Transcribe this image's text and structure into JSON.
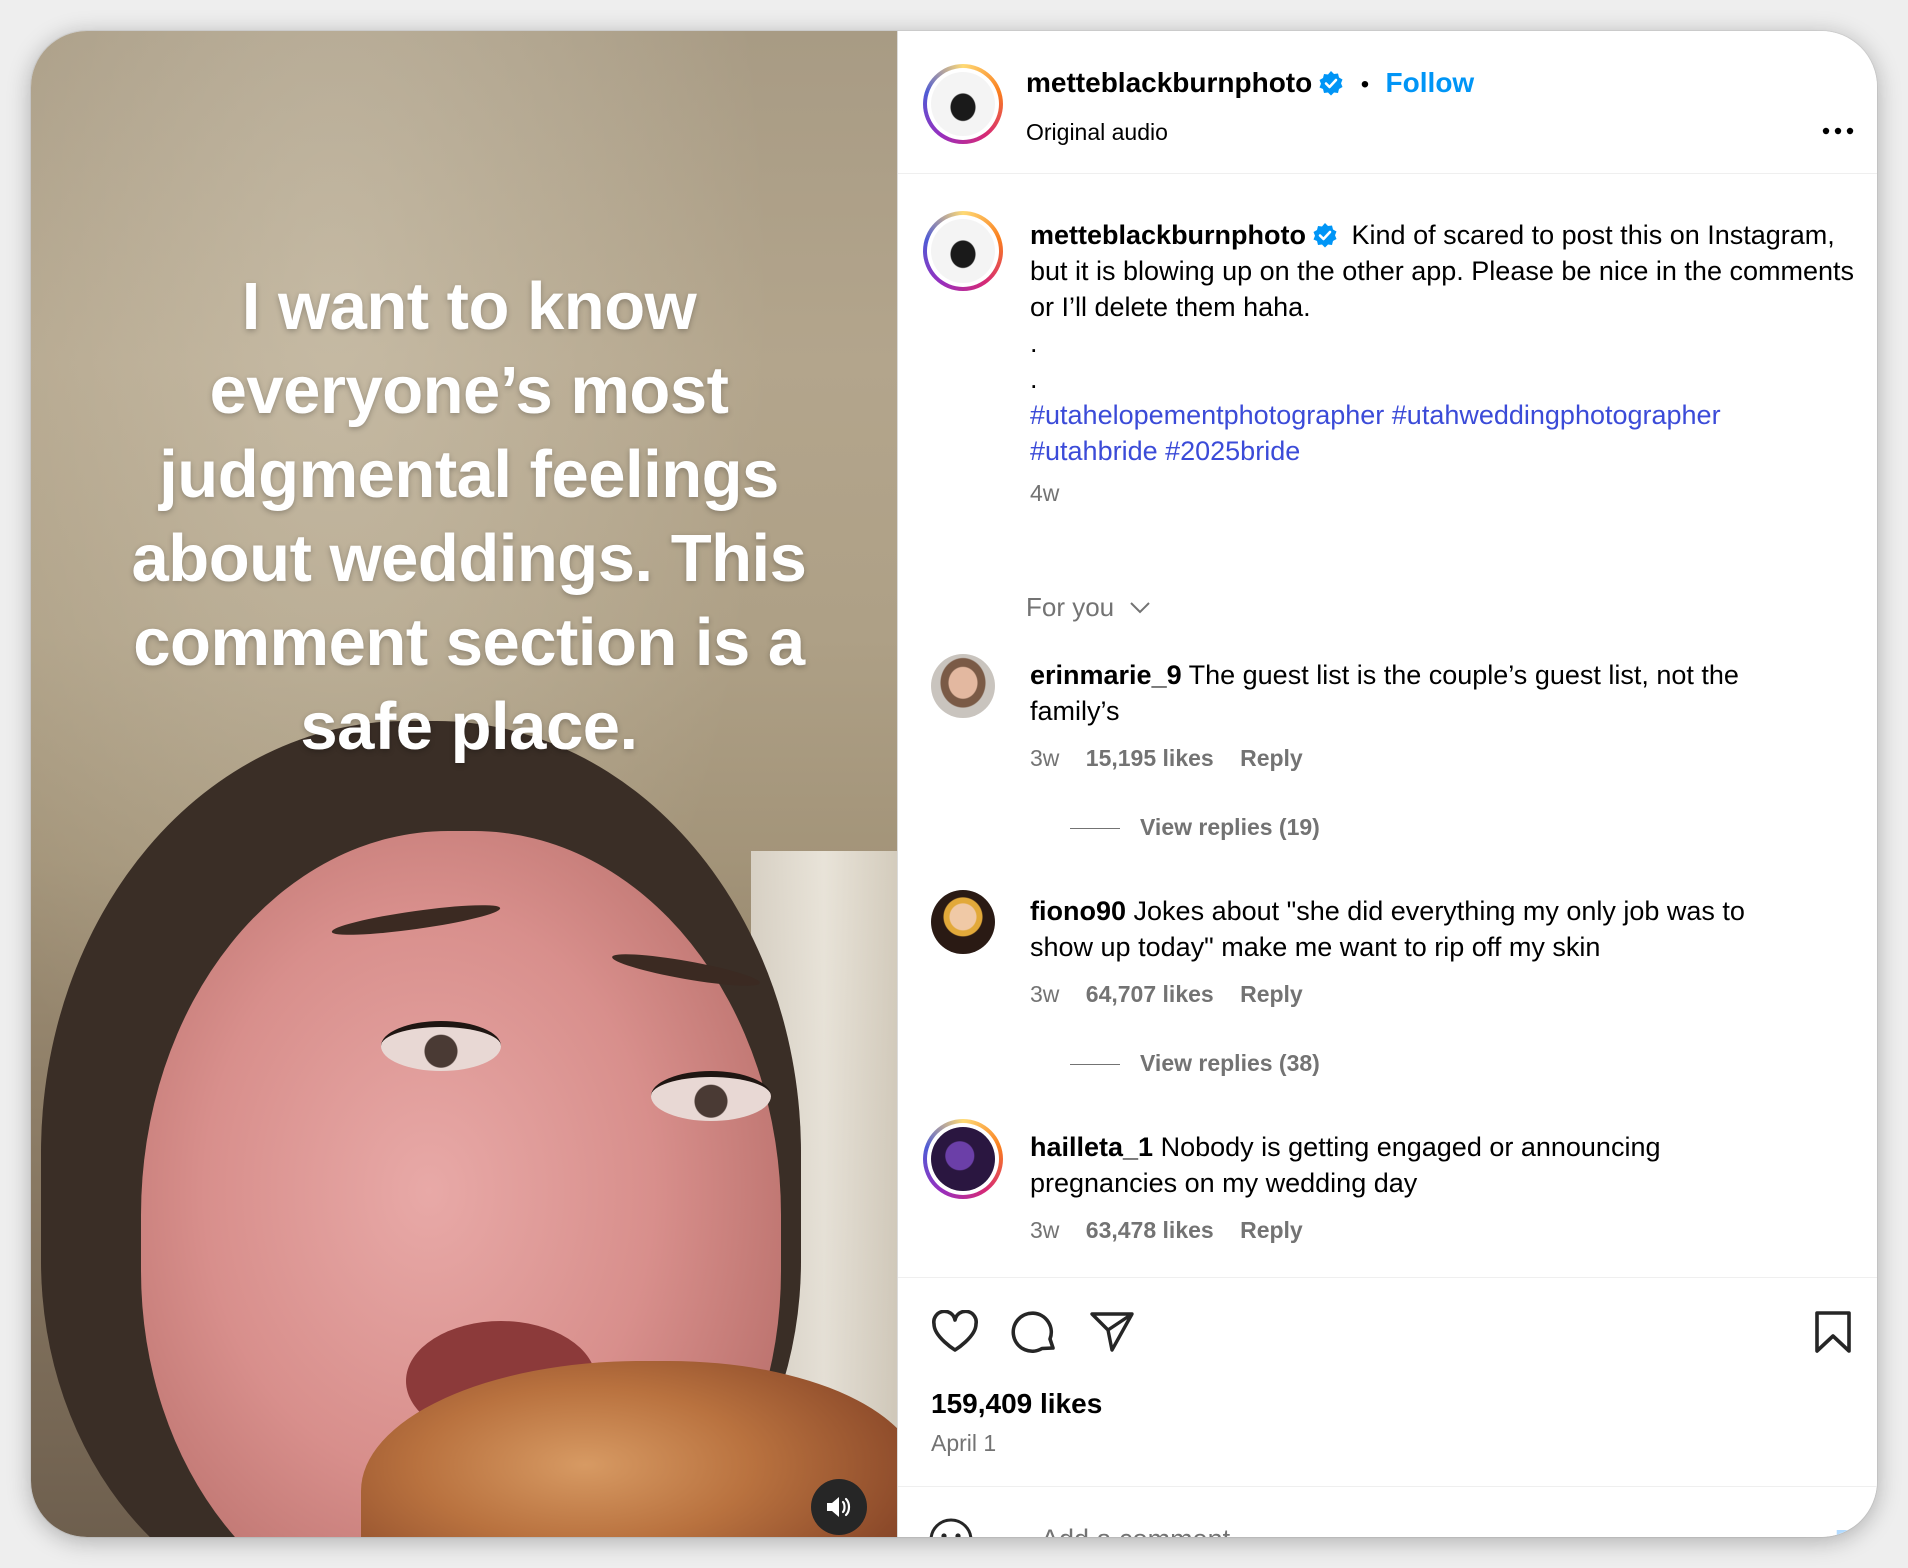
{
  "media": {
    "overlay_text": "I want to know everyone’s most judgmental feelings about weddings. This comment section is a safe place."
  },
  "header": {
    "username": "metteblackburnphoto",
    "separator": "•",
    "follow_label": "Follow",
    "audio_label": "Original audio",
    "more_icon": "more-horizontal-icon"
  },
  "caption": {
    "username": "metteblackburnphoto",
    "text": "Kind of scared to post this on Instagram, but it is blowing up on the other app. Please be nice in the comments or I’ll delete them haha.",
    "dot1": ".",
    "dot2": ".",
    "hashtags_line1": "#utahelopementphotographer #utahweddingphotographer",
    "hashtags_line2": "#utahbride #2025bride",
    "age": "4w"
  },
  "filter": {
    "label": "For you"
  },
  "comments": [
    {
      "username": "erinmarie_9",
      "text_line1": "The guest list is the couple’s guest list, not the",
      "text_line2": "family’s",
      "age": "3w",
      "likes": "15,195 likes",
      "reply": "Reply",
      "view_replies": "View replies (19)"
    },
    {
      "username": "fiono90",
      "text_line1": "Jokes about \"she did everything my only job was to",
      "text_line2": "show up today\" make me want to rip off my skin",
      "age": "3w",
      "likes": "64,707 likes",
      "reply": "Reply",
      "view_replies": "View replies (38)"
    },
    {
      "username": "hailleta_1",
      "text_line1": "Nobody is getting engaged or announcing",
      "text_line2": "pregnancies on my wedding day",
      "age": "3w",
      "likes": "63,478 likes",
      "reply": "Reply"
    }
  ],
  "footer": {
    "likes": "159,409 likes",
    "date": "April 1",
    "comment_placeholder": "Add a comment…",
    "post_label": "Post"
  },
  "colors": {
    "accent": "#0095f6",
    "hashtag": "#3b4bd8",
    "muted": "#737373",
    "verified": "#0095f6"
  }
}
